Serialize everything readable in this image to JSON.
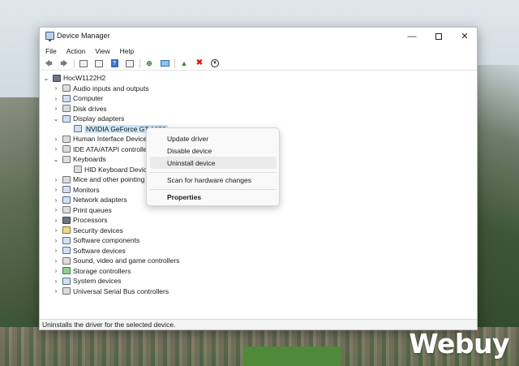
{
  "window": {
    "title": "Device Manager"
  },
  "menu": {
    "file": "File",
    "action": "Action",
    "view": "View",
    "help": "Help"
  },
  "toolbar": {
    "icons": [
      "back-icon",
      "forward-icon",
      "properties-icon",
      "hide-icon",
      "help-icon",
      "view-icon",
      "update-driver-icon",
      "scan-icon",
      "enable-device-icon",
      "uninstall-icon",
      "disable-icon"
    ],
    "help_glyph": "?"
  },
  "tree": {
    "root": "HocW1122H2",
    "items": [
      {
        "label": "Audio inputs and outputs",
        "state": "collapsed"
      },
      {
        "label": "Computer",
        "state": "collapsed"
      },
      {
        "label": "Disk drives",
        "state": "collapsed"
      },
      {
        "label": "Display adapters",
        "state": "expanded"
      },
      {
        "label": "NVIDIA GeForce GT 1030",
        "state": "child-selected"
      },
      {
        "label": "Human Interface Devices",
        "state": "collapsed"
      },
      {
        "label": "IDE ATA/ATAPI controllers",
        "state": "collapsed"
      },
      {
        "label": "Keyboards",
        "state": "expanded"
      },
      {
        "label": "HID Keyboard Device",
        "state": "child"
      },
      {
        "label": "Mice and other pointing devices",
        "state": "collapsed"
      },
      {
        "label": "Monitors",
        "state": "collapsed"
      },
      {
        "label": "Network adapters",
        "state": "collapsed"
      },
      {
        "label": "Print queues",
        "state": "collapsed"
      },
      {
        "label": "Processors",
        "state": "collapsed"
      },
      {
        "label": "Security devices",
        "state": "collapsed"
      },
      {
        "label": "Software components",
        "state": "collapsed"
      },
      {
        "label": "Software devices",
        "state": "collapsed"
      },
      {
        "label": "Sound, video and game controllers",
        "state": "collapsed"
      },
      {
        "label": "Storage controllers",
        "state": "collapsed"
      },
      {
        "label": "System devices",
        "state": "collapsed"
      },
      {
        "label": "Universal Serial Bus controllers",
        "state": "collapsed"
      }
    ]
  },
  "context_menu": {
    "update_driver": "Update driver",
    "disable_device": "Disable device",
    "uninstall_device": "Uninstall device",
    "scan_hardware": "Scan for hardware changes",
    "properties": "Properties",
    "highlighted": "Uninstall device"
  },
  "status": {
    "text": "Uninstalls the driver for the selected device."
  },
  "watermark": {
    "text": "Webuy"
  },
  "colors": {
    "selection": "#cce4f7",
    "accent": "#0067c0",
    "uninstall_red": "#d0201b"
  }
}
